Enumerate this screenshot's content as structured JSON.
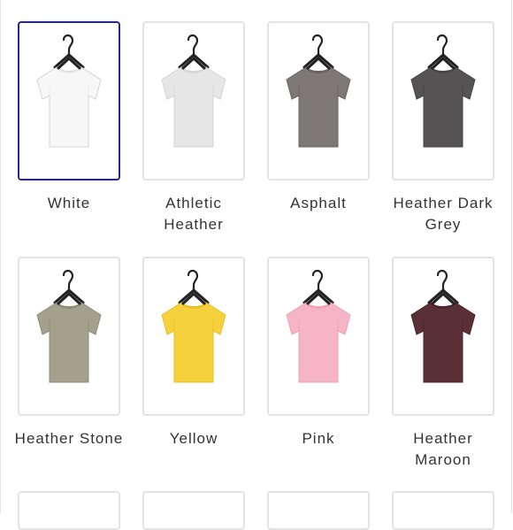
{
  "swatches": [
    {
      "name": "White",
      "color": "#f7f7f7",
      "shade": "#e9e9e9",
      "selected": true,
      "icon": "tshirt-icon"
    },
    {
      "name": "Athletic Heather",
      "color": "#e6e6e6",
      "shade": "#d6d6d6",
      "selected": false,
      "icon": "tshirt-icon"
    },
    {
      "name": "Asphalt",
      "color": "#7d7875",
      "shade": "#6a6562",
      "selected": false,
      "icon": "tshirt-icon"
    },
    {
      "name": "Heather Dark Grey",
      "color": "#555353",
      "shade": "#464444",
      "selected": false,
      "icon": "tshirt-icon"
    },
    {
      "name": "Heather Stone",
      "color": "#a3a08c",
      "shade": "#8f8c79",
      "selected": false,
      "icon": "tshirt-icon"
    },
    {
      "name": "Yellow",
      "color": "#f5d13c",
      "shade": "#e6c027",
      "selected": false,
      "icon": "tshirt-icon"
    },
    {
      "name": "Pink",
      "color": "#f6b5c6",
      "shade": "#eca3b6",
      "selected": false,
      "icon": "tshirt-icon"
    },
    {
      "name": "Heather Maroon",
      "color": "#5b2f36",
      "shade": "#4b252b",
      "selected": false,
      "icon": "tshirt-icon"
    }
  ],
  "colors": {
    "selected_border": "#28288a",
    "tile_border": "#e3e3e3",
    "label_text": "#333333",
    "hanger": "#222222"
  }
}
